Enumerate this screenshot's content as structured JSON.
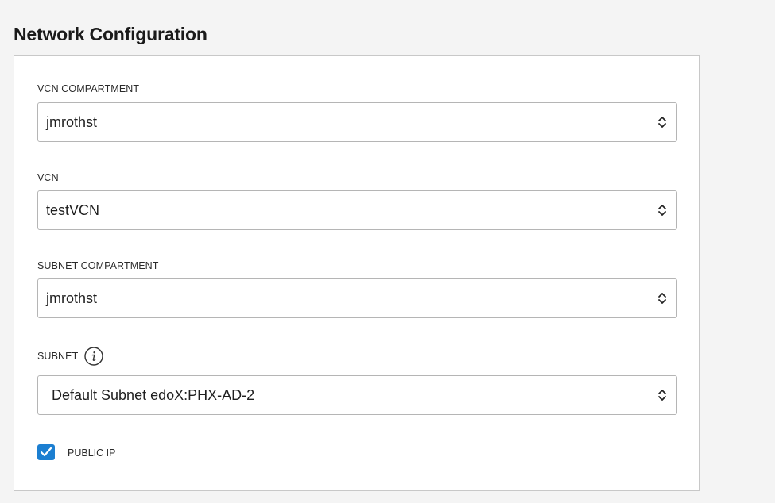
{
  "section": {
    "title": "Network Configuration"
  },
  "fields": {
    "vcn_compartment": {
      "label": "VCN COMPARTMENT",
      "value": "jmrothst"
    },
    "vcn": {
      "label": "VCN",
      "value": "testVCN"
    },
    "subnet_compartment": {
      "label": "SUBNET COMPARTMENT",
      "value": "jmrothst"
    },
    "subnet": {
      "label": "SUBNET",
      "value": "Default Subnet edoX:PHX-AD-2",
      "info_icon": "info-icon"
    }
  },
  "public_ip": {
    "label": "PUBLIC IP",
    "checked": true
  },
  "colors": {
    "checkbox_accent": "#1c7fd1",
    "panel_border": "#c8c8c8",
    "background": "#f4f4f4"
  }
}
